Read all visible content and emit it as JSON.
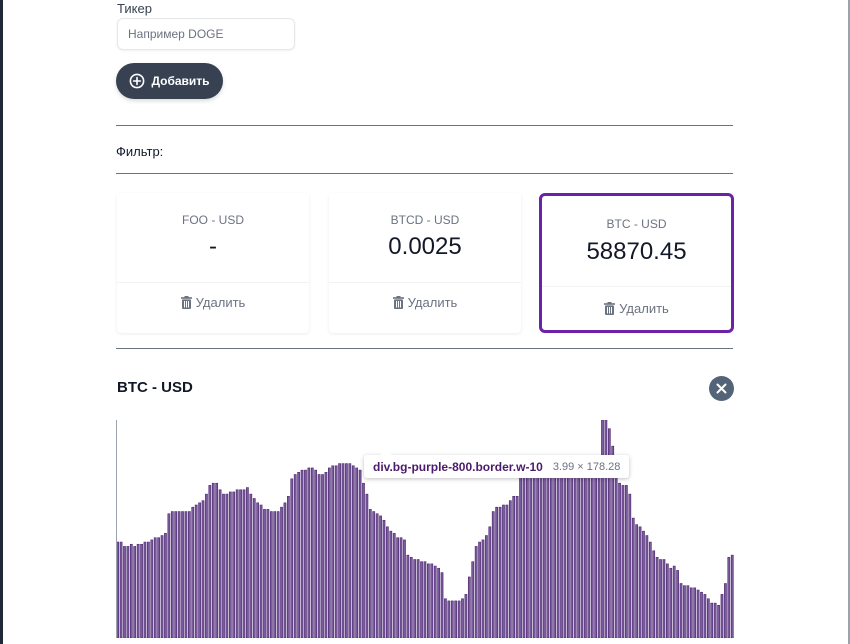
{
  "form": {
    "ticker_label": "Тикер",
    "ticker_placeholder": "Например DOGE",
    "ticker_value": "",
    "add_label": "Добавить"
  },
  "filter": {
    "label": "Фильтр:"
  },
  "tickers": [
    {
      "name": "FOO - USD",
      "price": "-",
      "delete_label": "Удалить",
      "selected": false
    },
    {
      "name": "BTCD - USD",
      "price": "0.0025",
      "delete_label": "Удалить",
      "selected": false
    },
    {
      "name": "BTC - USD",
      "price": "58870.45",
      "delete_label": "Удалить",
      "selected": true
    }
  ],
  "graph": {
    "title": "BTC - USD",
    "close_icon": "close-icon",
    "tooltip_selector": "div.bg-purple-800.border.w-10",
    "tooltip_size": "3.99 × 178.28",
    "bar_fill": "#7b5b9e",
    "bar_stroke": "#4b2770"
  },
  "colors": {
    "selected_border": "#6b21a8",
    "button_bg": "#374151",
    "close_bg": "#546478"
  },
  "chart_data": {
    "type": "bar",
    "title": "BTC - USD",
    "values": [
      44,
      44,
      42,
      42,
      43,
      42,
      43,
      43,
      44,
      44,
      45,
      46,
      46,
      47,
      48,
      57,
      58,
      58,
      58,
      58,
      58,
      58,
      60,
      61,
      62,
      63,
      66,
      70,
      71,
      71,
      68,
      66,
      66,
      67,
      67,
      68,
      68,
      68,
      69,
      66,
      64,
      62,
      61,
      59,
      59,
      58,
      58,
      58,
      60,
      62,
      65,
      73,
      75,
      76,
      77,
      77,
      78,
      78,
      77,
      75,
      75,
      76,
      78,
      79,
      79,
      80,
      80,
      80,
      80,
      79,
      78,
      77,
      71,
      66,
      59,
      58,
      57,
      56,
      54,
      51,
      49,
      48,
      46,
      46,
      45,
      38,
      37,
      36,
      36,
      35,
      35,
      34,
      34,
      33,
      32,
      30,
      18,
      17,
      17,
      17,
      17,
      18,
      20,
      28,
      35,
      42,
      44,
      45,
      47,
      51,
      58,
      60,
      60,
      61,
      61,
      63,
      65,
      65,
      75,
      77,
      79,
      80,
      80,
      80,
      80,
      80,
      80,
      80,
      80,
      80,
      80,
      80,
      80,
      80,
      80,
      80,
      80,
      80,
      80,
      80,
      80,
      82,
      100,
      100,
      96,
      88,
      76,
      71,
      70,
      70,
      66,
      55,
      52,
      51,
      49,
      47,
      44,
      40,
      37,
      36,
      36,
      34,
      32,
      33,
      31,
      25,
      24,
      24,
      23,
      23,
      22,
      21,
      20,
      18,
      16,
      16,
      15,
      20,
      25,
      37,
      38
    ]
  }
}
